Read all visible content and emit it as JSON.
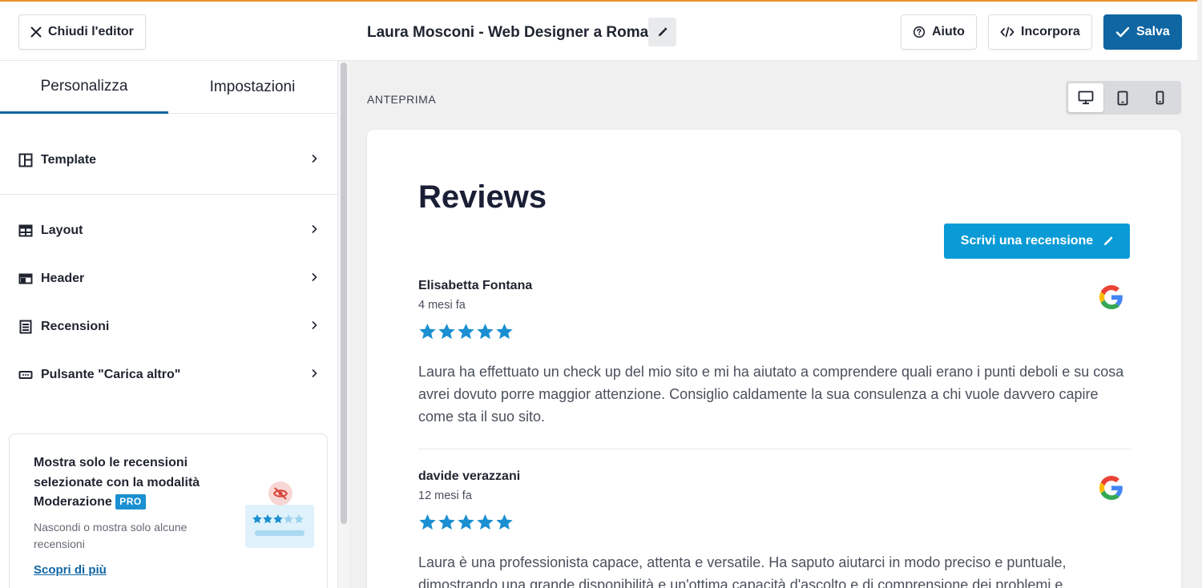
{
  "topbar": {
    "close_label": "Chiudi l'editor",
    "title": "Laura Mosconi - Web Designer a Roma",
    "help_label": "Aiuto",
    "embed_label": "Incorpora",
    "save_label": "Salva"
  },
  "sidebar": {
    "tabs": [
      {
        "label": "Personalizza",
        "active": true
      },
      {
        "label": "Impostazioni",
        "active": false
      }
    ],
    "items": [
      {
        "label": "Template",
        "icon": "template-icon"
      },
      {
        "label": "Layout",
        "icon": "layout-icon"
      },
      {
        "label": "Header",
        "icon": "header-icon"
      },
      {
        "label": "Recensioni",
        "icon": "reviews-list-icon"
      },
      {
        "label": "Pulsante \"Carica altro\"",
        "icon": "button-icon"
      }
    ],
    "promo": {
      "title": "Mostra solo le recensioni selezionate con la modalità Moderazione",
      "badge": "PRO",
      "subtitle": "Nascondi o mostra solo alcune recensioni",
      "link": "Scopri di più"
    }
  },
  "preview": {
    "label": "ANTEPRIMA",
    "devices": [
      "desktop-icon",
      "tablet-icon",
      "mobile-icon"
    ],
    "active_device": "desktop"
  },
  "widget": {
    "title": "Reviews",
    "write_button": "Scrivi una recensione",
    "reviews": [
      {
        "author": "Elisabetta Fontana",
        "date": "4 mesi fa",
        "rating": 5,
        "source": "google",
        "text": "Laura ha effettuato un check up del mio sito e mi ha aiutato a comprendere quali erano i punti deboli e su cosa avrei dovuto porre maggior attenzione. Consiglio caldamente la sua consulenza a chi vuole davvero capire come sta il suo sito."
      },
      {
        "author": "davide verazzani",
        "date": "12 mesi fa",
        "rating": 5,
        "source": "google",
        "text": "Laura è una professionista capace, attenta e versatile. Ha saputo aiutarci in modo preciso e puntuale, dimostrando una grande disponibilità e un'ottima capacità d'ascolto e di comprensione dei problemi e"
      }
    ]
  },
  "colors": {
    "accent_top": "#e8912e",
    "save_blue": "#0f66a3",
    "widget_blue": "#0a9bd6",
    "star_blue": "#1a8fd1"
  }
}
